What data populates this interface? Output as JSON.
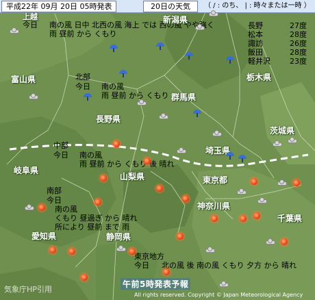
{
  "header": {
    "issued": "平成22年 09月 20日 05時発表",
    "day": "20日の天気",
    "legend": "（ / : のち、 | : 時々または一時 ）"
  },
  "prefectures": [
    "上越",
    "新潟県",
    "富山県",
    "長野県",
    "群馬県",
    "栃木県",
    "茨城県",
    "埼玉県",
    "岐阜県",
    "山梨県",
    "東京都",
    "神奈川県",
    "千葉県",
    "愛知県",
    "静岡県"
  ],
  "forecasts": {
    "joetsu_region": "今日",
    "joetsu_text": "南の風 日中 北西の風 海上 では 西の風 やや強く\n雨 昼前 から くもり",
    "hokubu_region": "北部",
    "hokubu_day": "今日",
    "hokubu_text": "南の風\n雨 昼前 から くもり",
    "chubu_region": "中部",
    "chubu_day": "今日",
    "chubu_text": "南の風\n雨 昼前 から くもり 後 晴れ",
    "nanbu_region": "南部",
    "nanbu_day": "今日",
    "nanbu_text": "南の風\nくもり 昼過ぎ から 晴れ\n所により 昼前 まで 雨",
    "tokyo_region": "東京地方",
    "tokyo_day": "今日",
    "tokyo_text": "北の風 後 南の風 くもり 夕方 から 晴れ"
  },
  "temperatures": [
    {
      "city": "長野",
      "temp": "27度"
    },
    {
      "city": "松本",
      "temp": "28度"
    },
    {
      "city": "諏訪",
      "temp": "26度"
    },
    {
      "city": "飯田",
      "temp": "28度"
    },
    {
      "city": "軽井沢",
      "temp": "23度"
    }
  ],
  "footer": {
    "source": "気象庁HP引用",
    "title": "午前5時発表予報",
    "copyright": "All rights reserved. Copyright © Japan Meteorological Agency"
  },
  "icons": {
    "sun": "sun-icon",
    "cloud": "cloud-icon",
    "rain": "umbrella-icon"
  },
  "colors": {
    "terrain": "#6e8f4e",
    "header": "#d9e6f8",
    "front_line": "#ffffff",
    "sun": "#e8301a",
    "rain": "#3a6fd0"
  }
}
